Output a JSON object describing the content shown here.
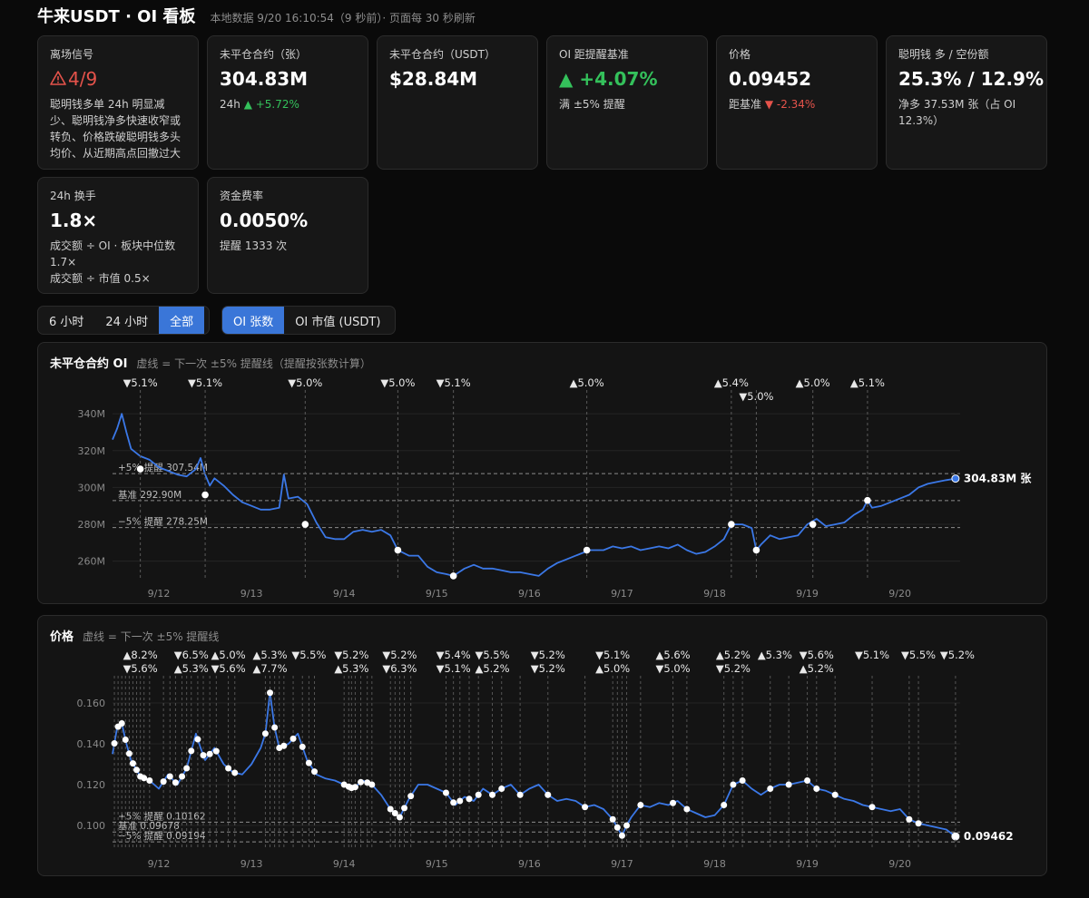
{
  "header": {
    "title": "牛来USDT · OI 看板",
    "meta": "本地数据 9/20 16:10:54（9 秒前）· 页面每 30 秒刷新"
  },
  "cards": {
    "exit": {
      "label": "离场信号",
      "value": "4/9",
      "desc": "聪明钱多单 24h 明显减少、聪明钱净多快速收窄或转负、价格跌破聪明钱多头均价、从近期高点回撤过大"
    },
    "oi_contracts": {
      "label": "未平仓合约（张）",
      "value": "304.83M",
      "sub_prefix": "24h",
      "sub_change": "▲ +5.72%"
    },
    "oi_usdt": {
      "label": "未平仓合约（USDT）",
      "value": "$28.84M"
    },
    "oi_baseline": {
      "label": "OI 距提醒基准",
      "value": "▲ +4.07%",
      "sub": "满 ±5% 提醒"
    },
    "price": {
      "label": "价格",
      "value": "0.09452",
      "sub_prefix": "距基准",
      "sub_change": "▼ -2.34%"
    },
    "smart": {
      "label": "聪明钱 多 / 空份额",
      "value": "25.3% / 12.9%",
      "sub": "净多 37.53M 张（占 OI 12.3%）"
    },
    "turnover": {
      "label": "24h 换手",
      "value": "1.8×",
      "sub1": "成交额 ÷ OI · 板块中位数 1.7×",
      "sub2": "成交额 ÷ 市值 0.5×"
    },
    "funding": {
      "label": "资金费率",
      "value": "0.0050%",
      "sub": "提醒 1333 次"
    }
  },
  "range_tabs": [
    "6 小时",
    "24 小时",
    "全部"
  ],
  "range_active": "全部",
  "unit_tabs": [
    "OI 张数",
    "OI 市值 (USDT)"
  ],
  "unit_active": "OI 张数",
  "colors": {
    "line": "#3b78e7",
    "up": "#34c15b",
    "down": "#e5534b",
    "bg": "#0a0a0a",
    "card": "#171717"
  },
  "chart_data": [
    {
      "type": "line",
      "title": "未平仓合约 OI",
      "subtitle": "虚线 = 下一次 ±5% 提醒线（提醒按张数计算）",
      "x_ticks": [
        "9/12",
        "9/13",
        "9/14",
        "9/15",
        "9/16",
        "9/17",
        "9/18",
        "9/19",
        "9/20"
      ],
      "y_ticks": [
        "340M",
        "320M",
        "300M",
        "280M",
        "260M"
      ],
      "ylim": [
        250,
        345
      ],
      "y_unit": "M",
      "series": [
        {
          "values": [
            [
              11.5,
              326
            ],
            [
              11.55,
              332
            ],
            [
              11.6,
              340
            ],
            [
              11.65,
              330
            ],
            [
              11.7,
              321
            ],
            [
              11.8,
              317
            ],
            [
              11.9,
              315
            ],
            [
              12.0,
              311
            ],
            [
              12.1,
              309
            ],
            [
              12.2,
              307
            ],
            [
              12.3,
              306
            ],
            [
              12.4,
              310
            ],
            [
              12.45,
              316
            ],
            [
              12.5,
              307
            ],
            [
              12.55,
              301
            ],
            [
              12.6,
              305
            ],
            [
              12.7,
              301
            ],
            [
              12.8,
              296
            ],
            [
              12.9,
              292
            ],
            [
              13.0,
              290
            ],
            [
              13.1,
              288
            ],
            [
              13.2,
              288
            ],
            [
              13.3,
              289
            ],
            [
              13.35,
              307
            ],
            [
              13.4,
              294
            ],
            [
              13.5,
              295
            ],
            [
              13.6,
              291
            ],
            [
              13.7,
              281
            ],
            [
              13.8,
              273
            ],
            [
              13.9,
              272
            ],
            [
              14.0,
              272
            ],
            [
              14.1,
              276
            ],
            [
              14.2,
              277
            ],
            [
              14.3,
              276
            ],
            [
              14.4,
              277
            ],
            [
              14.5,
              274
            ],
            [
              14.58,
              266
            ],
            [
              14.7,
              263
            ],
            [
              14.8,
              263
            ],
            [
              14.9,
              257
            ],
            [
              15.0,
              254
            ],
            [
              15.1,
              253
            ],
            [
              15.18,
              252
            ],
            [
              15.3,
              256
            ],
            [
              15.4,
              258
            ],
            [
              15.5,
              256
            ],
            [
              15.6,
              256
            ],
            [
              15.7,
              255
            ],
            [
              15.8,
              254
            ],
            [
              15.9,
              254
            ],
            [
              16.0,
              253
            ],
            [
              16.1,
              252
            ],
            [
              16.2,
              256
            ],
            [
              16.3,
              259
            ],
            [
              16.4,
              261
            ],
            [
              16.5,
              263
            ],
            [
              16.6,
              265
            ],
            [
              16.62,
              266
            ],
            [
              16.8,
              266
            ],
            [
              16.9,
              268
            ],
            [
              17.0,
              267
            ],
            [
              17.1,
              268
            ],
            [
              17.2,
              266
            ],
            [
              17.3,
              267
            ],
            [
              17.4,
              268
            ],
            [
              17.5,
              267
            ],
            [
              17.6,
              269
            ],
            [
              17.7,
              266
            ],
            [
              17.8,
              264
            ],
            [
              17.9,
              265
            ],
            [
              18.0,
              268
            ],
            [
              18.1,
              272
            ],
            [
              18.18,
              280
            ],
            [
              18.3,
              280
            ],
            [
              18.4,
              278
            ],
            [
              18.45,
              266
            ],
            [
              18.5,
              269
            ],
            [
              18.6,
              274
            ],
            [
              18.7,
              272
            ],
            [
              18.8,
              273
            ],
            [
              18.9,
              274
            ],
            [
              19.0,
              280
            ],
            [
              19.1,
              283
            ],
            [
              19.2,
              279
            ],
            [
              19.3,
              280
            ],
            [
              19.4,
              281
            ],
            [
              19.5,
              285
            ],
            [
              19.6,
              288
            ],
            [
              19.65,
              293
            ],
            [
              19.7,
              289
            ],
            [
              19.8,
              290
            ],
            [
              19.9,
              292
            ],
            [
              20.0,
              294
            ],
            [
              20.1,
              296
            ],
            [
              20.2,
              300
            ],
            [
              20.3,
              302
            ],
            [
              20.4,
              303
            ],
            [
              20.5,
              304
            ],
            [
              20.6,
              304.83
            ]
          ]
        }
      ],
      "baseline": {
        "value": 292.9,
        "label": "基准 292.90M"
      },
      "upper": {
        "value": 307.54,
        "label": "+5% 提醒 307.54M"
      },
      "lower": {
        "value": 278.25,
        "label": "−5% 提醒 278.25M"
      },
      "last_label": "304.83M 张",
      "alerts": [
        {
          "x": 11.8,
          "y": 310,
          "label": "▼5.1%",
          "row": 0
        },
        {
          "x": 12.5,
          "y": 296,
          "label": "▼5.1%",
          "row": 0
        },
        {
          "x": 13.58,
          "y": 280,
          "label": "▼5.0%",
          "row": 0
        },
        {
          "x": 14.58,
          "y": 266,
          "label": "▼5.0%",
          "row": 0
        },
        {
          "x": 15.18,
          "y": 252,
          "label": "▼5.1%",
          "row": 0
        },
        {
          "x": 16.62,
          "y": 266,
          "label": "▲5.0%",
          "row": 0
        },
        {
          "x": 18.18,
          "y": 280,
          "label": "▲5.4%",
          "row": 0
        },
        {
          "x": 18.45,
          "y": 266,
          "label": "▼5.0%",
          "row": 1
        },
        {
          "x": 19.06,
          "y": 280,
          "label": "▲5.0%",
          "row": 0
        },
        {
          "x": 19.65,
          "y": 293,
          "label": "▲5.1%",
          "row": 0
        }
      ]
    },
    {
      "type": "line",
      "title": "价格",
      "subtitle": "虚线 = 下一次 ±5% 提醒线",
      "x_ticks": [
        "9/12",
        "9/13",
        "9/14",
        "9/15",
        "9/16",
        "9/17",
        "9/18",
        "9/19",
        "9/20"
      ],
      "y_ticks": [
        "0.160",
        "0.140",
        "0.120",
        "0.100"
      ],
      "ylim": [
        0.088,
        0.168
      ],
      "series": [
        {
          "values": [
            [
              11.5,
              0.135
            ],
            [
              11.55,
              0.148
            ],
            [
              11.6,
              0.15
            ],
            [
              11.65,
              0.14
            ],
            [
              11.7,
              0.132
            ],
            [
              11.8,
              0.124
            ],
            [
              11.9,
              0.122
            ],
            [
              12.0,
              0.118
            ],
            [
              12.1,
              0.125
            ],
            [
              12.2,
              0.12
            ],
            [
              12.3,
              0.128
            ],
            [
              12.4,
              0.145
            ],
            [
              12.45,
              0.138
            ],
            [
              12.5,
              0.132
            ],
            [
              12.6,
              0.138
            ],
            [
              12.7,
              0.13
            ],
            [
              12.8,
              0.126
            ],
            [
              12.9,
              0.125
            ],
            [
              13.0,
              0.13
            ],
            [
              13.1,
              0.138
            ],
            [
              13.15,
              0.145
            ],
            [
              13.2,
              0.165
            ],
            [
              13.25,
              0.148
            ],
            [
              13.3,
              0.138
            ],
            [
              13.4,
              0.14
            ],
            [
              13.5,
              0.145
            ],
            [
              13.6,
              0.132
            ],
            [
              13.7,
              0.125
            ],
            [
              13.8,
              0.123
            ],
            [
              13.9,
              0.122
            ],
            [
              14.0,
              0.12
            ],
            [
              14.1,
              0.118
            ],
            [
              14.2,
              0.122
            ],
            [
              14.3,
              0.12
            ],
            [
              14.4,
              0.115
            ],
            [
              14.5,
              0.108
            ],
            [
              14.6,
              0.104
            ],
            [
              14.7,
              0.113
            ],
            [
              14.8,
              0.12
            ],
            [
              14.9,
              0.12
            ],
            [
              15.0,
              0.118
            ],
            [
              15.1,
              0.116
            ],
            [
              15.2,
              0.11
            ],
            [
              15.3,
              0.114
            ],
            [
              15.4,
              0.112
            ],
            [
              15.5,
              0.118
            ],
            [
              15.6,
              0.115
            ],
            [
              15.7,
              0.118
            ],
            [
              15.8,
              0.12
            ],
            [
              15.9,
              0.115
            ],
            [
              16.0,
              0.118
            ],
            [
              16.1,
              0.12
            ],
            [
              16.2,
              0.115
            ],
            [
              16.3,
              0.112
            ],
            [
              16.4,
              0.113
            ],
            [
              16.5,
              0.112
            ],
            [
              16.6,
              0.109
            ],
            [
              16.7,
              0.11
            ],
            [
              16.8,
              0.108
            ],
            [
              16.9,
              0.103
            ],
            [
              17.0,
              0.095
            ],
            [
              17.05,
              0.1
            ],
            [
              17.1,
              0.104
            ],
            [
              17.2,
              0.11
            ],
            [
              17.3,
              0.109
            ],
            [
              17.4,
              0.111
            ],
            [
              17.5,
              0.11
            ],
            [
              17.6,
              0.112
            ],
            [
              17.7,
              0.108
            ],
            [
              17.8,
              0.106
            ],
            [
              17.9,
              0.104
            ],
            [
              18.0,
              0.105
            ],
            [
              18.1,
              0.11
            ],
            [
              18.2,
              0.12
            ],
            [
              18.3,
              0.122
            ],
            [
              18.4,
              0.118
            ],
            [
              18.5,
              0.115
            ],
            [
              18.6,
              0.118
            ],
            [
              18.7,
              0.12
            ],
            [
              18.8,
              0.12
            ],
            [
              18.9,
              0.121
            ],
            [
              19.0,
              0.122
            ],
            [
              19.1,
              0.118
            ],
            [
              19.2,
              0.117
            ],
            [
              19.3,
              0.115
            ],
            [
              19.4,
              0.113
            ],
            [
              19.5,
              0.112
            ],
            [
              19.6,
              0.11
            ],
            [
              19.7,
              0.109
            ],
            [
              19.8,
              0.108
            ],
            [
              19.9,
              0.107
            ],
            [
              20.0,
              0.108
            ],
            [
              20.1,
              0.103
            ],
            [
              20.2,
              0.101
            ],
            [
              20.3,
              0.1
            ],
            [
              20.4,
              0.099
            ],
            [
              20.5,
              0.098
            ],
            [
              20.6,
              0.09462
            ]
          ]
        }
      ],
      "baseline": {
        "value": 0.09678,
        "label": "基准 0.09678"
      },
      "upper": {
        "value": 0.10162,
        "label": "+5% 提醒 0.10162"
      },
      "lower": {
        "value": 0.09194,
        "label": "−5% 提醒 0.09194"
      },
      "last_label": "0.09462",
      "alerts_up_row": [
        "▲8.2%",
        "▼6.5%",
        "▲5.0%",
        "▲5.3%",
        "▼5.5%",
        "▼5.2%",
        "▼5.2%",
        "▼5.4%",
        "▼5.5%",
        "▼5.2%",
        "▼5.1%",
        "▲5.6%",
        "▲5.2%",
        "▲5.3%",
        "▼5.6%",
        "▼5.1%",
        "▼5.5%",
        "▼5.2%"
      ],
      "alerts_down_row": [
        "▼5.6%",
        "▲5.3%",
        "▼5.6%",
        "▲7.7%",
        "▲5.3%",
        "▼6.3%",
        "▼5.1%",
        "▲5.2%",
        "▼5.2%",
        "▲5.0%",
        "▼5.0%",
        "▼5.2%",
        "▲5.2%"
      ]
    }
  ]
}
